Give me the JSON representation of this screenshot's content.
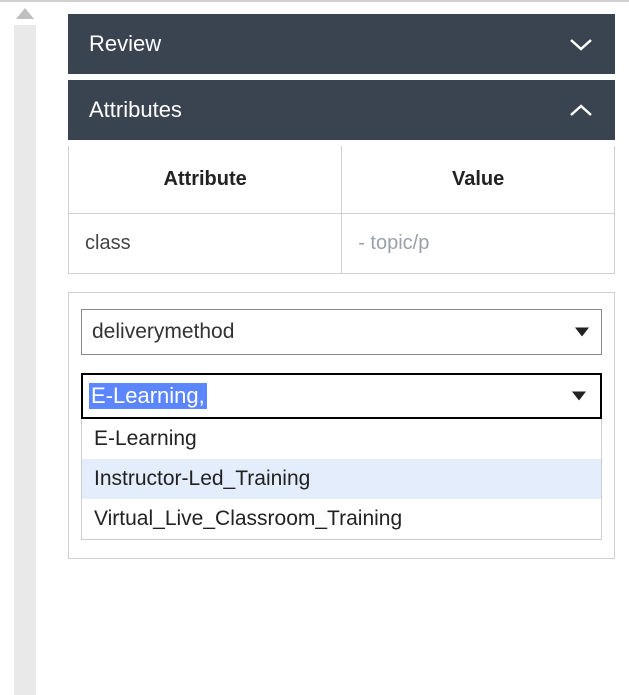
{
  "sections": {
    "review": {
      "title": "Review",
      "expanded": false
    },
    "attributes": {
      "title": "Attributes",
      "expanded": true,
      "headers": {
        "attribute": "Attribute",
        "value": "Value"
      },
      "rows": [
        {
          "name": "class",
          "value": "- topic/p"
        }
      ]
    }
  },
  "attributeSelector": {
    "selected": "deliverymethod"
  },
  "valueSelector": {
    "input": "E-Learning,",
    "options": [
      "E-Learning",
      "Instructor-Led_Training",
      "Virtual_Live_Classroom_Training"
    ],
    "hoverIndex": 1
  }
}
